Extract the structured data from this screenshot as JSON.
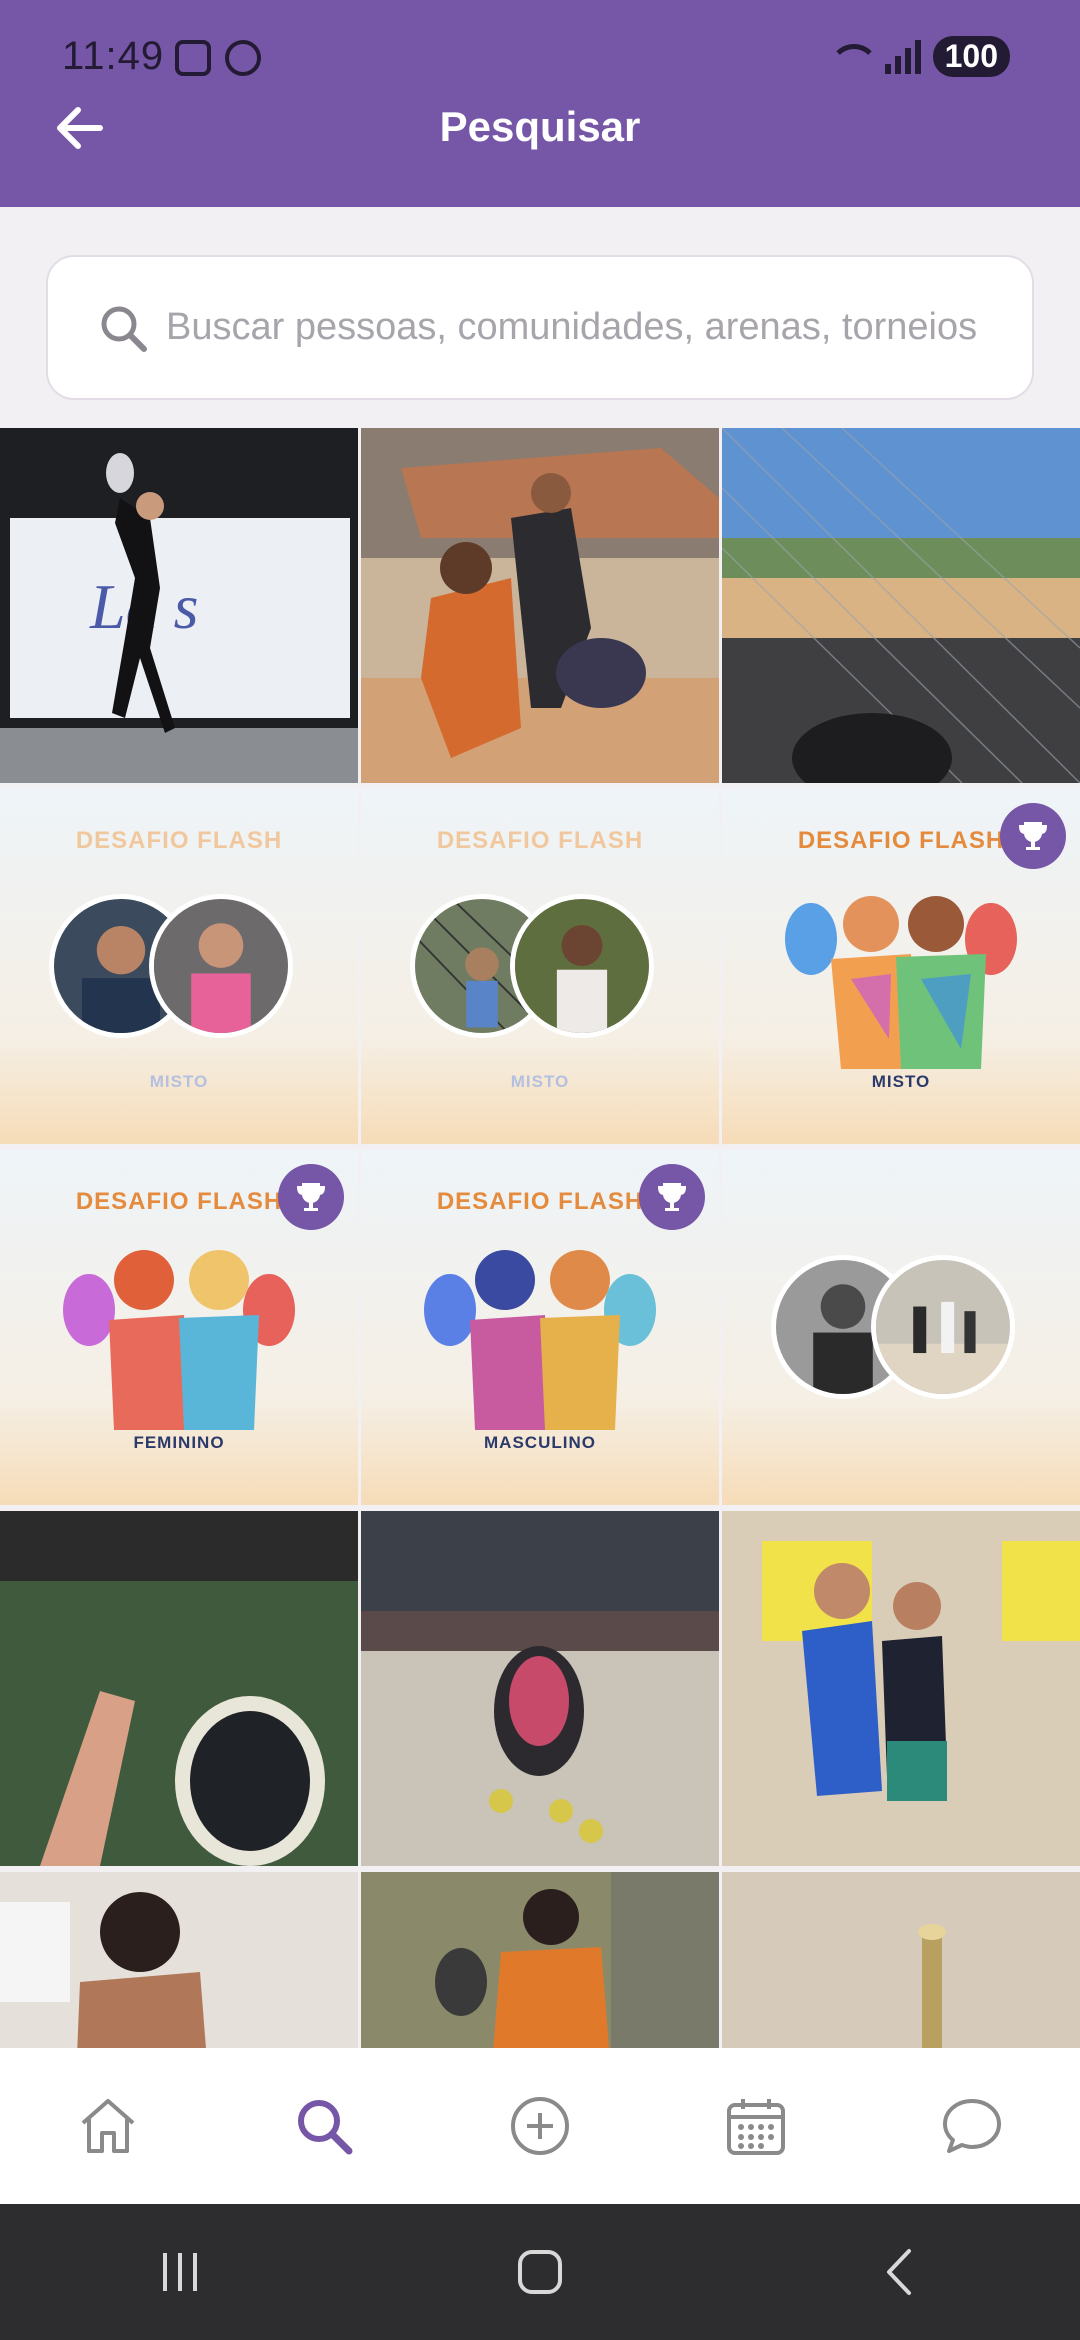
{
  "status_bar": {
    "time": "11:49",
    "battery": "100"
  },
  "header": {
    "title": "Pesquisar",
    "back_icon": "arrow-left-icon"
  },
  "search": {
    "placeholder": "Buscar pessoas, comunidades, arenas, torneios"
  },
  "colors": {
    "brand": "#7656a6",
    "nav_active": "#7656a6",
    "nav_inactive": "#8a8a8a"
  },
  "grid": {
    "posters": [
      {
        "title": "DESAFIO FLASH",
        "subtitle": "MISTO"
      },
      {
        "title": "DESAFIO FLASH",
        "subtitle": "MISTO"
      },
      {
        "title": "DESAFIO FLASH",
        "subtitle": "MISTO"
      },
      {
        "title": "DESAFIO FLASH",
        "subtitle": "FEMININO"
      },
      {
        "title": "DESAFIO FLASH",
        "subtitle": "MASCULINO"
      }
    ]
  },
  "bottom_nav": [
    "home-icon",
    "search-icon",
    "add-circle-icon",
    "calendar-icon",
    "chat-icon"
  ]
}
